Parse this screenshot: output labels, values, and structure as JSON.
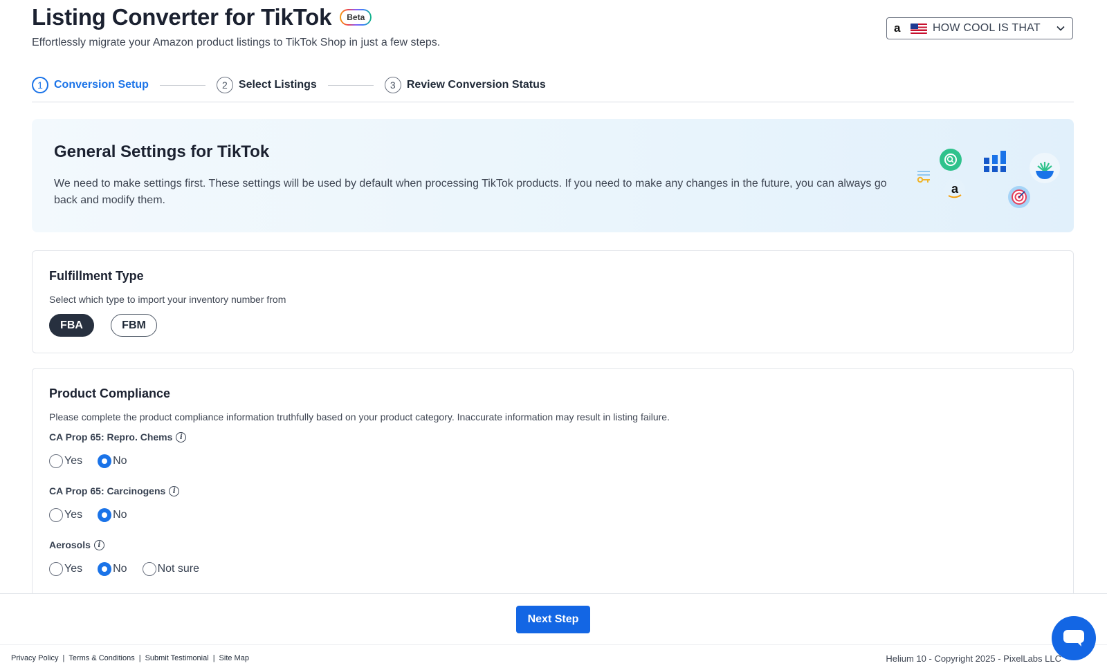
{
  "header": {
    "title": "Listing Converter for TikTok",
    "badge": "Beta",
    "subtitle": "Effortlessly migrate your Amazon product listings to TikTok Shop in just a few steps."
  },
  "account_selector": {
    "marketplace_icon": "amazon-icon",
    "flag_icon": "us-flag-icon",
    "selected": "HOW COOL IS THAT"
  },
  "steps": [
    {
      "number": "1",
      "label": "Conversion Setup",
      "active": true
    },
    {
      "number": "2",
      "label": "Select Listings",
      "active": false
    },
    {
      "number": "3",
      "label": "Review Conversion Status",
      "active": false
    }
  ],
  "banner": {
    "title": "General Settings for TikTok",
    "text": "We need to make settings first. These settings will be used by default when processing TikTok products. If you need to make any changes in the future, you can always go back and modify them.",
    "icons": [
      "key-list-icon",
      "search-bubble-icon",
      "amazon-logo-icon",
      "bar-chart-icon",
      "target-icon",
      "plant-bowl-icon"
    ]
  },
  "fulfillment": {
    "title": "Fulfillment Type",
    "description": "Select which type to import your inventory number from",
    "options": [
      "FBA",
      "FBM"
    ],
    "selected": "FBA"
  },
  "compliance": {
    "title": "Product Compliance",
    "description": "Please complete the product compliance information truthfully based on your product category. Inaccurate information may result in listing failure.",
    "questions": [
      {
        "label": "CA Prop 65: Repro. Chems",
        "options": [
          "Yes",
          "No"
        ],
        "selected": "No"
      },
      {
        "label": "CA Prop 65: Carcinogens",
        "options": [
          "Yes",
          "No"
        ],
        "selected": "No"
      },
      {
        "label": "Aerosols",
        "options": [
          "Yes",
          "No",
          "Not sure"
        ],
        "selected": "No"
      }
    ]
  },
  "actions": {
    "next": "Next Step"
  },
  "footer": {
    "links": [
      "Privacy Policy",
      "Terms & Conditions",
      "Submit Testimonial",
      "Site Map"
    ],
    "separator": "|",
    "copyright": "Helium 10 - Copyright 2025 - PixelLabs LLC"
  },
  "colors": {
    "accent": "#1a73e8",
    "primary_button": "#1366e4",
    "selected_pill": "#27303f"
  }
}
